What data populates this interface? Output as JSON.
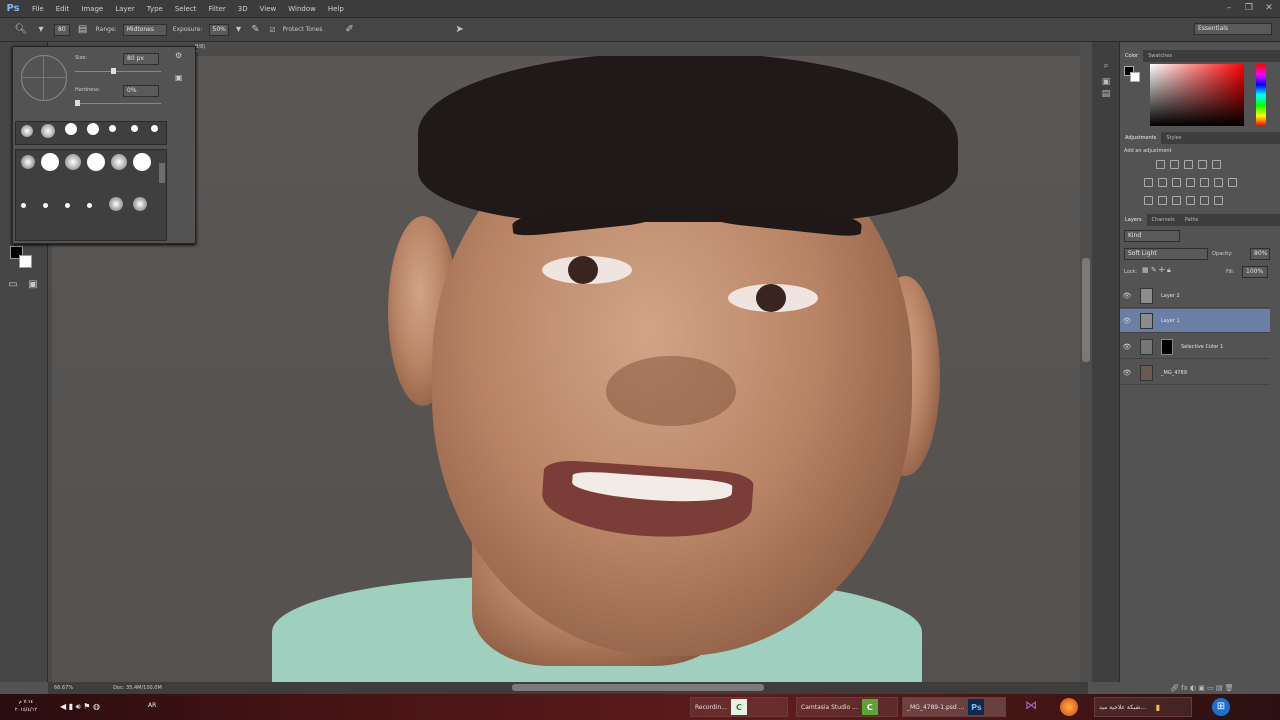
{
  "app": {
    "logo": "Ps",
    "menu": [
      "File",
      "Edit",
      "Image",
      "Layer",
      "Type",
      "Select",
      "Filter",
      "3D",
      "View",
      "Window",
      "Help"
    ],
    "window_controls": [
      "–",
      "❐",
      "✕"
    ]
  },
  "options_bar": {
    "brush_size_field": "80",
    "range_label": "Range:",
    "range_value": "Midtones",
    "exposure_label": "Exposure:",
    "exposure_value": "50%",
    "protect_tones_label": "Protect Tones",
    "workspace": "Essentials"
  },
  "brush_popup": {
    "size_label": "Size:",
    "size_value": "80 px",
    "hardness_label": "Hardness:",
    "hardness_value": "0%",
    "size_fraction": 0.45,
    "hardness_fraction": 0.0
  },
  "canvas": {
    "doc_tab_hint": "B/8) *"
  },
  "status": {
    "zoom": "66.67%",
    "doc": "Doc: 35.4M/100.0M"
  },
  "color_panel": {
    "tabs": [
      "Color",
      "Swatches"
    ],
    "accent": "#ff0000"
  },
  "adjustments_panel": {
    "tabs": [
      "Adjustments",
      "Styles"
    ],
    "title": "Add an adjustment"
  },
  "layers_panel": {
    "tabs": [
      "Layers",
      "Channels",
      "Paths"
    ],
    "kind_filter": "Kind",
    "blend_mode": "Soft Light",
    "opacity_label": "Opacity:",
    "opacity_value": "80%",
    "lock_label": "Lock:",
    "fill_label": "Fill:",
    "fill_value": "100%",
    "layers": [
      {
        "name": "Layer 2",
        "selected": false
      },
      {
        "name": "Layer 1",
        "selected": true
      },
      {
        "name": "Selective Color 1",
        "selected": false
      },
      {
        "name": "_MG_4789",
        "selected": false
      }
    ]
  },
  "taskbar": {
    "clock_time": "٧:١٤ م",
    "clock_date": "٢٠١٥/٤/١٢",
    "lang": "AR",
    "tasks": [
      {
        "label": "Recordin...",
        "icon": "C"
      },
      {
        "label": "Camtasia Studio ...",
        "icon": "C"
      },
      {
        "label": "_MG_4789-1.psd ...",
        "icon": "Ps"
      },
      {
        "label": "شبكة علاجية ميد...",
        "icon": "▮"
      }
    ]
  }
}
